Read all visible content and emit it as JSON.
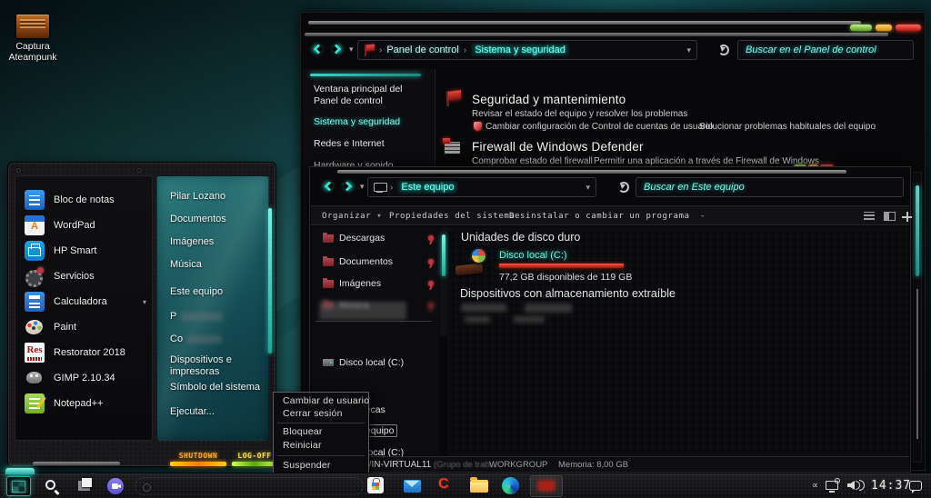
{
  "desktop": {
    "shortcut_label": "Captura Ateampunk"
  },
  "glyphs": {
    "breadcrumb_sep": "›",
    "dropdown": "▾",
    "toolbar_more": "-",
    "calc_expand": "▾",
    "tray_more": "∝"
  },
  "icons": {
    "wordpad_letter": "A",
    "restorator_text": "Res",
    "ccleaner_letter": "C"
  },
  "control_panel_window": {
    "breadcrumb": {
      "item1": "Panel de control",
      "item2": "Sistema y seguridad"
    },
    "search_value": "Buscar en el Panel de control",
    "sidebar": {
      "items": [
        {
          "label": "Ventana principal del Panel de control"
        },
        {
          "label": "Sistema y seguridad"
        },
        {
          "label": "Redes e Internet"
        },
        {
          "label": "Hardware y sonido"
        }
      ]
    },
    "sections": [
      {
        "title": "Seguridad y mantenimiento",
        "subtitle": "Revisar el estado del equipo y resolver los problemas",
        "link1": "Cambiar configuración de Control de cuentas de usuario",
        "link2": "Solucionar problemas habituales del equipo"
      },
      {
        "title": "Firewall de Windows Defender",
        "link1": "Comprobar estado del firewall",
        "link2": "Permitir una aplicación a través de Firewall de Windows"
      }
    ]
  },
  "explorer_window": {
    "breadcrumb": {
      "item1": "Este equipo"
    },
    "search_value": "Buscar en Este equipo",
    "toolbar": {
      "organize": "Organizar",
      "system_props": "Propiedades del sistema",
      "uninstall": "Desinstalar o cambiar un programa"
    },
    "sidebar": {
      "items": [
        {
          "label": "Descargas"
        },
        {
          "label": "Documentos"
        },
        {
          "label": "Imágenes"
        },
        {
          "label": "Música"
        },
        {
          "label": "Disco local (C:)"
        },
        {
          "label": "Bibliotecas"
        },
        {
          "label": "Este equipo"
        },
        {
          "label": "Disco local (C:)"
        }
      ]
    },
    "content": {
      "group1_title": "Unidades de disco duro",
      "drive": {
        "name": "Disco local (C:)",
        "free_space": "77,2 GB disponibles de 119 GB"
      },
      "group2_title": "Dispositivos con almacenamiento extraíble"
    },
    "status_bar": {
      "computer_name": "WIN-VIRTUAL11",
      "computer_detail": "(Grupo de trab...",
      "workgroup": "WORKGROUP",
      "memory": "Memoria: 8,00 GB"
    }
  },
  "start_menu": {
    "apps": [
      {
        "label": "Bloc de notas"
      },
      {
        "label": "WordPad"
      },
      {
        "label": "HP Smart"
      },
      {
        "label": "Servicios"
      },
      {
        "label": "Calculadora"
      },
      {
        "label": "Paint"
      },
      {
        "label": "Restorator 2018"
      },
      {
        "label": "GIMP 2.10.34"
      },
      {
        "label": "Notepad++"
      }
    ],
    "places": [
      {
        "label": "Pilar Lozano"
      },
      {
        "label": "Documentos"
      },
      {
        "label": "Imágenes"
      },
      {
        "label": "Música"
      },
      {
        "label": "Este equipo"
      },
      {
        "label": "P"
      },
      {
        "label": "Co"
      },
      {
        "label": "Dispositivos e impresoras"
      },
      {
        "label": "Símbolo del sistema"
      },
      {
        "label": "Ejecutar..."
      }
    ],
    "shutdown_label": "SHUTDOWN",
    "logoff_label": "LOG-OFF"
  },
  "power_menu": {
    "items": [
      {
        "label": "Cambiar de usuario"
      },
      {
        "label": "Cerrar sesión"
      },
      {
        "label": "Bloquear"
      },
      {
        "label": "Reiniciar"
      },
      {
        "label": "Suspender"
      }
    ]
  },
  "taskbar": {
    "clock": "14:37"
  }
}
